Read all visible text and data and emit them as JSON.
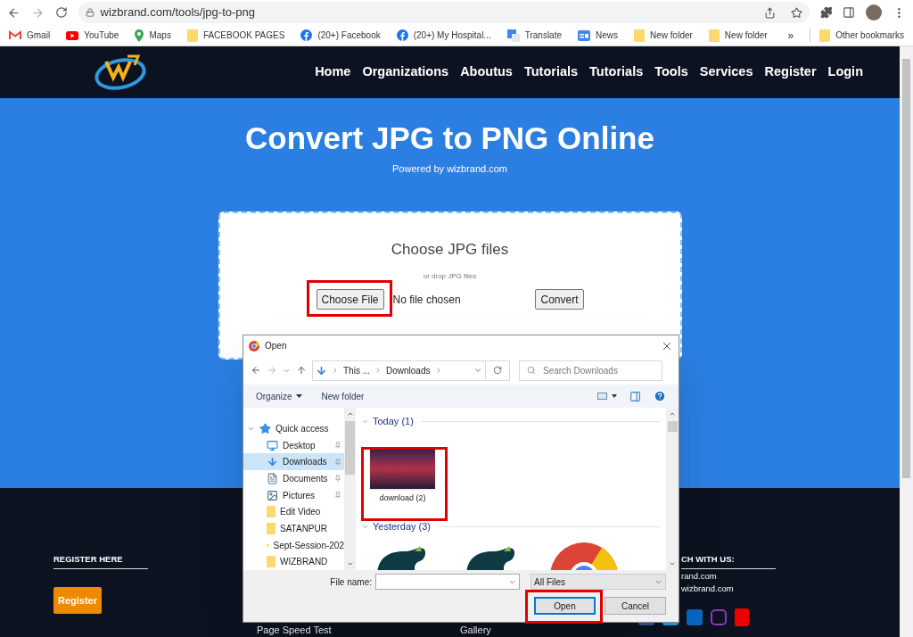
{
  "address_bar": {
    "url": "wizbrand.com/tools/jpg-to-png"
  },
  "bookmarks": [
    {
      "label": "Gmail",
      "kind": "gmail"
    },
    {
      "label": "YouTube",
      "kind": "youtube"
    },
    {
      "label": "Maps",
      "kind": "maps"
    },
    {
      "label": "FACEBOOK PAGES",
      "kind": "folder"
    },
    {
      "label": "(20+) Facebook",
      "kind": "facebook"
    },
    {
      "label": "(20+) My Hospital...",
      "kind": "facebook"
    },
    {
      "label": "Translate",
      "kind": "translate"
    },
    {
      "label": "News",
      "kind": "news"
    },
    {
      "label": "New folder",
      "kind": "folder"
    },
    {
      "label": "New folder",
      "kind": "folder"
    }
  ],
  "bookmarks_overflow": "»",
  "other_bookmarks": "Other bookmarks",
  "site_nav": {
    "links": [
      "Home",
      "Organizations",
      "Aboutus",
      "Tutorials",
      "Tutorials",
      "Tools",
      "Services",
      "Register",
      "Login"
    ]
  },
  "hero": {
    "title": "Convert JPG to PNG Online",
    "subtitle": "Powered by wizbrand.com"
  },
  "upload_card": {
    "heading": "Choose JPG files",
    "hint": "or drop JPG files",
    "file_button": "Choose File",
    "file_status": "No file chosen",
    "convert_button": "Convert"
  },
  "footer": {
    "register_heading": "REGISTER HERE",
    "register_button": "Register",
    "links": [
      "Page Speed Test",
      "Gallery"
    ],
    "contact_heading": "CH WITH US:",
    "contact_lines": [
      "rand.com",
      "wizbrand.com"
    ]
  },
  "dialog": {
    "title": "Open",
    "breadcrumb": [
      "This ...",
      "Downloads"
    ],
    "search_placeholder": "Search Downloads",
    "organize": "Organize",
    "new_folder": "New folder",
    "nav": [
      {
        "label": "Quick access",
        "kind": "quick",
        "pinned": false,
        "selected": false
      },
      {
        "label": "Desktop",
        "kind": "desktop",
        "pinned": true,
        "selected": false
      },
      {
        "label": "Downloads",
        "kind": "download",
        "pinned": true,
        "selected": true
      },
      {
        "label": "Documents",
        "kind": "document",
        "pinned": true,
        "selected": false
      },
      {
        "label": "Pictures",
        "kind": "picture",
        "pinned": true,
        "selected": false
      },
      {
        "label": "Edit Video",
        "kind": "folder",
        "pinned": false,
        "selected": false
      },
      {
        "label": "SATANPUR",
        "kind": "folder",
        "pinned": false,
        "selected": false
      },
      {
        "label": "Sept-Session-202",
        "kind": "folder",
        "pinned": false,
        "selected": false
      },
      {
        "label": "WIZBRAND",
        "kind": "folder",
        "pinned": false,
        "selected": false
      }
    ],
    "groups": [
      {
        "label": "Today (1)",
        "files": [
          {
            "name": "download (2)",
            "kind": "photo"
          }
        ]
      },
      {
        "label": "Yesterday (3)",
        "files": [
          {
            "kind": "elephant"
          },
          {
            "kind": "elephant"
          },
          {
            "kind": "chrome"
          }
        ]
      }
    ],
    "file_name_label": "File name:",
    "file_type": "All Files",
    "open_button": "Open",
    "cancel_button": "Cancel"
  }
}
